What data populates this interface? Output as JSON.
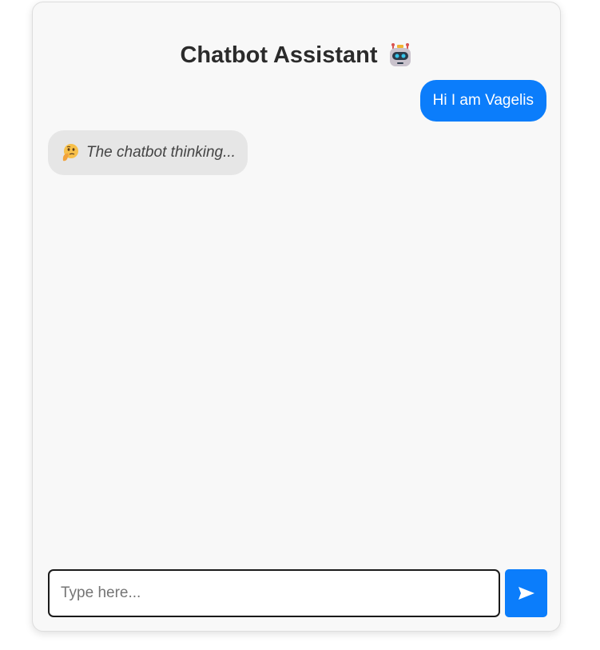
{
  "header": {
    "title": "Chatbot Assistant",
    "icon": "robot-icon"
  },
  "messages": [
    {
      "role": "user",
      "text": "Hi I am Vagelis"
    },
    {
      "role": "bot",
      "text": "The chatbot thinking...",
      "icon": "thinking-face-icon"
    }
  ],
  "composer": {
    "placeholder": "Type here...",
    "value": "",
    "send_icon": "send-arrow-icon"
  },
  "colors": {
    "accent": "#0b7dfb",
    "card_background": "#f8f8f8",
    "bot_bubble": "#e6e6e6",
    "title_text": "#2b2b2b"
  }
}
